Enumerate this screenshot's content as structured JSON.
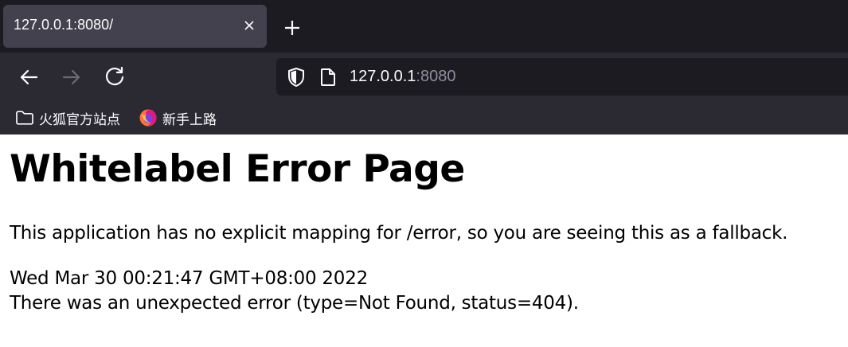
{
  "browser": {
    "tab": {
      "title": "127.0.0.1:8080/"
    },
    "url": {
      "host": "127.0.0.1",
      "port": ":8080"
    },
    "bookmarks": [
      {
        "label": "火狐官方站点",
        "icon": "folder-icon"
      },
      {
        "label": "新手上路",
        "icon": "firefox-icon"
      }
    ],
    "colors": {
      "tabbar": "#1c1b22",
      "toolbar": "#2b2a33",
      "active_tab": "#42414d"
    }
  },
  "page": {
    "title": "Whitelabel Error Page",
    "message": "This application has no explicit mapping for /error, so you are seeing this as a fallback.",
    "timestamp": "Wed Mar 30 00:21:47 GMT+08:00 2022",
    "error": "There was an unexpected error (type=Not Found, status=404)."
  }
}
